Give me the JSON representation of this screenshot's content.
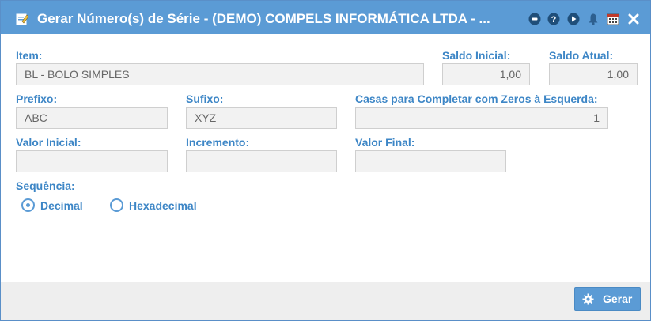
{
  "dialog": {
    "title": "Gerar Número(s) de Série - (DEMO) COMPELS INFORMÁTICA LTDA - ...",
    "buttons": [
      "minimize-icon",
      "help-icon",
      "play-icon",
      "bell-icon",
      "calendar-icon",
      "close-icon"
    ]
  },
  "form": {
    "item_label": "Item:",
    "item_value": "BL - BOLO SIMPLES",
    "saldo_inicial_label": "Saldo Inicial:",
    "saldo_inicial_value": "1,00",
    "saldo_atual_label": "Saldo Atual:",
    "saldo_atual_value": "1,00",
    "prefixo_label": "Prefixo:",
    "prefixo_value": "ABC",
    "sufixo_label": "Sufixo:",
    "sufixo_value": "XYZ",
    "casas_label": "Casas para Completar com Zeros à Esquerda:",
    "casas_value": "1",
    "valor_inicial_label": "Valor Inicial:",
    "valor_inicial_value": "",
    "incremento_label": "Incremento:",
    "incremento_value": "",
    "valor_final_label": "Valor Final:",
    "valor_final_value": "",
    "sequencia_label": "Sequência:",
    "sequencia_options": [
      "Decimal",
      "Hexadecimal"
    ],
    "sequencia_selected": "Decimal"
  },
  "footer": {
    "gerar_label": "Gerar"
  },
  "colors": {
    "accent": "#5b9bd5",
    "label": "#3d86c6"
  }
}
